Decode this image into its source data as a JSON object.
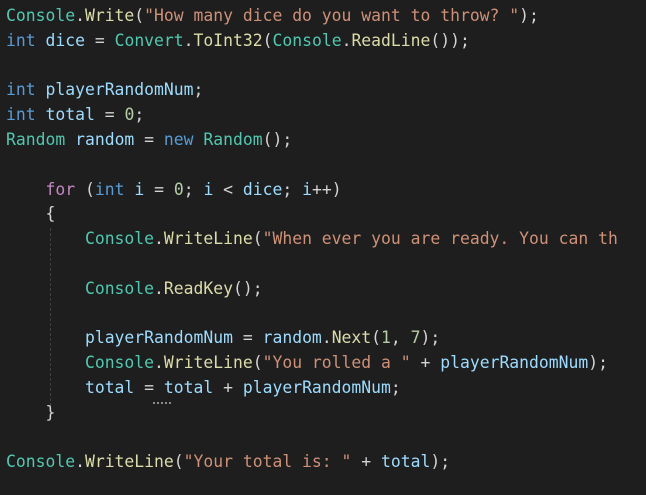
{
  "editor": {
    "language": "csharp",
    "colors": {
      "background": "#1e1e1e",
      "type": "#4ec9b0",
      "keyword": "#569cd6",
      "control": "#c586c0",
      "variable": "#9cdcfe",
      "method": "#dcdcaa",
      "string": "#ce9178",
      "number": "#b5cea8",
      "punctuation": "#d4d4d4",
      "indent_guide": "#404040"
    },
    "lines": [
      [
        {
          "t": "Console",
          "k": "type"
        },
        {
          "t": ".",
          "k": "punct"
        },
        {
          "t": "Write",
          "k": "method"
        },
        {
          "t": "(",
          "k": "punct"
        },
        {
          "t": "\"How many dice do you want to throw? \"",
          "k": "str"
        },
        {
          "t": ");",
          "k": "punct"
        }
      ],
      [
        {
          "t": "int",
          "k": "kw"
        },
        {
          "t": " ",
          "k": "punct"
        },
        {
          "t": "dice",
          "k": "var"
        },
        {
          "t": " = ",
          "k": "op"
        },
        {
          "t": "Convert",
          "k": "type"
        },
        {
          "t": ".",
          "k": "punct"
        },
        {
          "t": "ToInt32",
          "k": "method"
        },
        {
          "t": "(",
          "k": "punct"
        },
        {
          "t": "Console",
          "k": "type"
        },
        {
          "t": ".",
          "k": "punct"
        },
        {
          "t": "ReadLine",
          "k": "method"
        },
        {
          "t": "());",
          "k": "punct"
        }
      ],
      [],
      [
        {
          "t": "int",
          "k": "kw"
        },
        {
          "t": " ",
          "k": "punct"
        },
        {
          "t": "playerRandomNum",
          "k": "var"
        },
        {
          "t": ";",
          "k": "punct"
        }
      ],
      [
        {
          "t": "int",
          "k": "kw"
        },
        {
          "t": " ",
          "k": "punct"
        },
        {
          "t": "total",
          "k": "var"
        },
        {
          "t": " = ",
          "k": "op"
        },
        {
          "t": "0",
          "k": "num"
        },
        {
          "t": ";",
          "k": "punct"
        }
      ],
      [
        {
          "t": "Random",
          "k": "type"
        },
        {
          "t": " ",
          "k": "punct"
        },
        {
          "t": "random",
          "k": "var"
        },
        {
          "t": " = ",
          "k": "op"
        },
        {
          "t": "new",
          "k": "kw"
        },
        {
          "t": " ",
          "k": "punct"
        },
        {
          "t": "Random",
          "k": "type"
        },
        {
          "t": "();",
          "k": "punct"
        }
      ],
      [],
      [
        {
          "t": "    ",
          "k": "punct"
        },
        {
          "t": "for",
          "k": "ctl"
        },
        {
          "t": " (",
          "k": "punct"
        },
        {
          "t": "int",
          "k": "kw"
        },
        {
          "t": " ",
          "k": "punct"
        },
        {
          "t": "i",
          "k": "var"
        },
        {
          "t": " = ",
          "k": "op"
        },
        {
          "t": "0",
          "k": "num"
        },
        {
          "t": "; ",
          "k": "punct"
        },
        {
          "t": "i",
          "k": "var"
        },
        {
          "t": " < ",
          "k": "op"
        },
        {
          "t": "dice",
          "k": "var"
        },
        {
          "t": "; ",
          "k": "punct"
        },
        {
          "t": "i",
          "k": "var"
        },
        {
          "t": "++)",
          "k": "punct"
        }
      ],
      [
        {
          "t": "    {",
          "k": "punct"
        }
      ],
      [
        {
          "t": "        ",
          "k": "punct"
        },
        {
          "t": "Console",
          "k": "type"
        },
        {
          "t": ".",
          "k": "punct"
        },
        {
          "t": "WriteLine",
          "k": "method"
        },
        {
          "t": "(",
          "k": "punct"
        },
        {
          "t": "\"When ever you are ready. You can th",
          "k": "str"
        }
      ],
      [],
      [
        {
          "t": "        ",
          "k": "punct"
        },
        {
          "t": "Console",
          "k": "type"
        },
        {
          "t": ".",
          "k": "punct"
        },
        {
          "t": "ReadKey",
          "k": "method"
        },
        {
          "t": "();",
          "k": "punct"
        }
      ],
      [],
      [
        {
          "t": "        ",
          "k": "punct"
        },
        {
          "t": "playerRandomNum",
          "k": "var"
        },
        {
          "t": " = ",
          "k": "op"
        },
        {
          "t": "random",
          "k": "var"
        },
        {
          "t": ".",
          "k": "punct"
        },
        {
          "t": "Next",
          "k": "method"
        },
        {
          "t": "(",
          "k": "punct"
        },
        {
          "t": "1",
          "k": "num"
        },
        {
          "t": ", ",
          "k": "punct"
        },
        {
          "t": "7",
          "k": "num"
        },
        {
          "t": ");",
          "k": "punct"
        }
      ],
      [
        {
          "t": "        ",
          "k": "punct"
        },
        {
          "t": "Console",
          "k": "type"
        },
        {
          "t": ".",
          "k": "punct"
        },
        {
          "t": "WriteLine",
          "k": "method"
        },
        {
          "t": "(",
          "k": "punct"
        },
        {
          "t": "\"You rolled a \"",
          "k": "str"
        },
        {
          "t": " + ",
          "k": "op"
        },
        {
          "t": "playerRandomNum",
          "k": "var"
        },
        {
          "t": ");",
          "k": "punct"
        }
      ],
      [
        {
          "t": "        ",
          "k": "punct"
        },
        {
          "t": "total",
          "k": "var"
        },
        {
          "t": " = ",
          "k": "op"
        },
        {
          "t": "total",
          "k": "var"
        },
        {
          "t": " + ",
          "k": "op"
        },
        {
          "t": "playerRandomNum",
          "k": "var"
        },
        {
          "t": ";",
          "k": "punct"
        }
      ],
      [
        {
          "t": "    }",
          "k": "punct"
        }
      ],
      [],
      [
        {
          "t": "Console",
          "k": "type"
        },
        {
          "t": ".",
          "k": "punct"
        },
        {
          "t": "WriteLine",
          "k": "method"
        },
        {
          "t": "(",
          "k": "punct"
        },
        {
          "t": "\"Your total is: \"",
          "k": "str"
        },
        {
          "t": " + ",
          "k": "op"
        },
        {
          "t": "total",
          "k": "var"
        },
        {
          "t": ");",
          "k": "punct"
        }
      ]
    ]
  }
}
